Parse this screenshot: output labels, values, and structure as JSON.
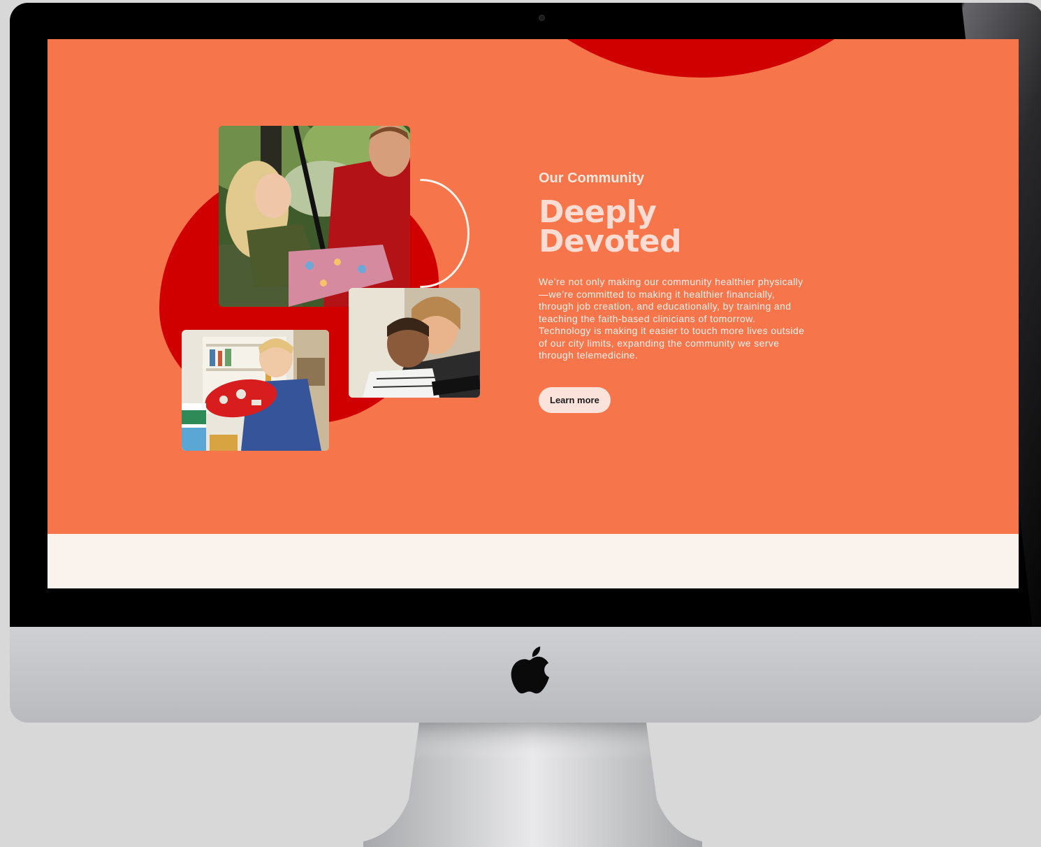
{
  "page": {
    "eyebrow": "Our Community",
    "headline_line1": "Deeply",
    "headline_line2": "Devoted",
    "body": "We’re not only making our community healthier physically—we’re committed to making it healthier financially, through job creation, and educationally, by training and teaching the faith-based clinicians of tomorrow. Technology is making it easier to touch more lives outside of our city limits, expanding the community we serve through telemedicine.",
    "cta_label": "Learn more"
  },
  "colors": {
    "hero_background": "#f7754a",
    "accent_red": "#d10000",
    "headline": "#fbdcd3",
    "button_bg": "#fbe3dc",
    "lower_band": "#faf2ed"
  },
  "icons": [
    "apple-logo-icon",
    "camera-icon"
  ]
}
